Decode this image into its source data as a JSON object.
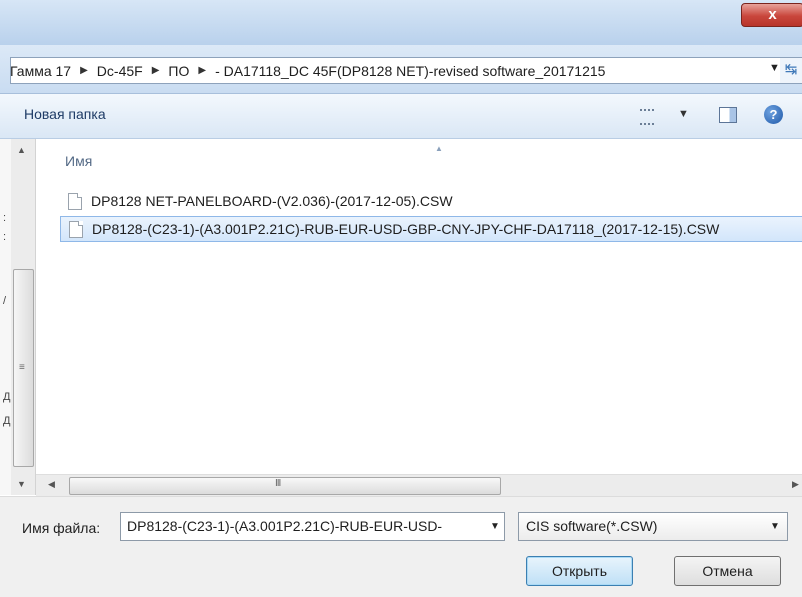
{
  "window": {
    "close_glyph": "x"
  },
  "address": {
    "crumbs": [
      "Гамма 17",
      "Dc-45F",
      "ПО",
      "- DA17118_DC 45F(DP8128 NET)-revised software_20171215"
    ]
  },
  "toolbar": {
    "new_folder_label": "Новая папка"
  },
  "filelist": {
    "column_name": "Имя",
    "files": [
      {
        "name": "DP8128 NET-PANELBOARD-(V2.036)-(2017-12-05).CSW",
        "selected": false
      },
      {
        "name": "DP8128-(C23-1)-(A3.001P2.21C)-RUB-EUR-USD-GBP-CNY-JPY-CHF-DA17118_(2017-12-15).CSW",
        "selected": true
      }
    ]
  },
  "hscroll": {
    "grip": "III"
  },
  "footer": {
    "filename_label": "Имя файла:",
    "filename_value": "DP8128-(C23-1)-(A3.001P2.21C)-RUB-EUR-USD-",
    "filetype_value": "CIS software(*.CSW)",
    "open_label": "Открыть",
    "cancel_label": "Отмена"
  }
}
